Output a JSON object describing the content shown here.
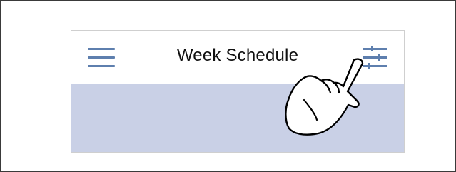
{
  "header": {
    "title": "Week Schedule",
    "menu_icon": "hamburger-menu-icon",
    "filter_icon": "sliders-filter-icon"
  },
  "overlay": {
    "gesture_icon": "tapping-hand-icon"
  },
  "colors": {
    "accent": "#5e7fae",
    "content_background": "#c9d0e6",
    "header_background": "#ffffff",
    "frame_border": "#3a3a3a"
  }
}
